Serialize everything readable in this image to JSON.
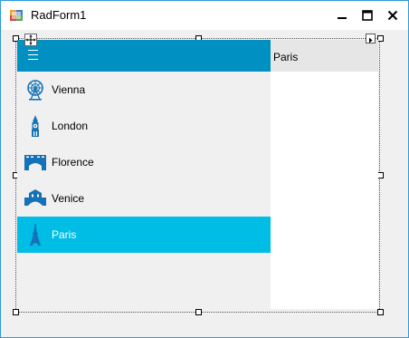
{
  "window": {
    "title": "RadForm1",
    "controls": {
      "minimize": "minimize-icon",
      "maximize": "maximize-icon",
      "close": "close-icon"
    }
  },
  "navigation": {
    "header_icon": "hamburger-icon",
    "items": [
      {
        "label": "Vienna",
        "icon": "ferris-wheel-icon"
      },
      {
        "label": "London",
        "icon": "big-ben-icon"
      },
      {
        "label": "Florence",
        "icon": "bridge-icon"
      },
      {
        "label": "Venice",
        "icon": "rialto-bridge-icon"
      },
      {
        "label": "Paris",
        "icon": "eiffel-tower-icon",
        "selected": true
      }
    ],
    "selected_index": 4
  },
  "content": {
    "header_title": "Paris"
  },
  "colors": {
    "accent_header": "#0190c2",
    "selected_item": "#00bde6",
    "icon_blue": "#1572b6",
    "window_border": "#2d9ad8"
  }
}
